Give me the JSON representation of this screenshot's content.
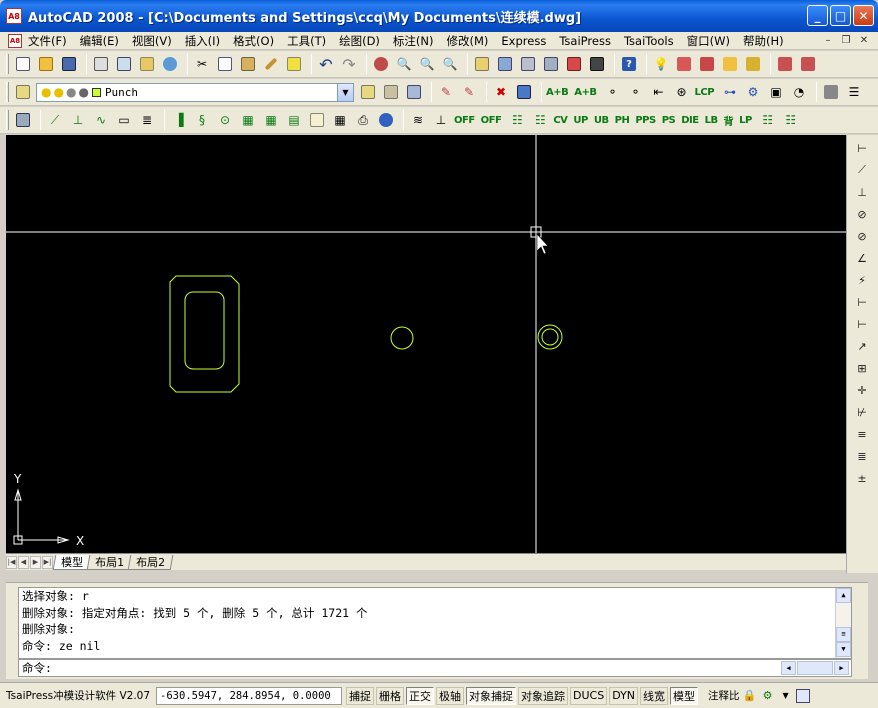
{
  "window": {
    "app_icon_text": "A8",
    "title": "AutoCAD 2008 - [C:\\Documents and Settings\\ccq\\My Documents\\连续模.dwg]",
    "buttons": {
      "minimize": "_",
      "maximize": "□",
      "close": "✕"
    }
  },
  "menu": {
    "items": [
      "文件(F)",
      "编辑(E)",
      "视图(V)",
      "插入(I)",
      "格式(O)",
      "工具(T)",
      "绘图(D)",
      "标注(N)",
      "修改(M)",
      "Express",
      "TsaiPress",
      "TsaiTools",
      "窗口(W)",
      "帮助(H)"
    ],
    "mdi_buttons": {
      "minimize": "–",
      "restore": "❐",
      "close": "✕"
    }
  },
  "toolbar_layers": {
    "layer_name": "Punch"
  },
  "toolbar_tsai": {
    "labels": [
      "A+B",
      "A+B",
      "LCP",
      "OFF",
      "OFF",
      "CV",
      "UP",
      "UB",
      "PH",
      "PPS",
      "PS",
      "DIE",
      "LB",
      "背",
      "LP"
    ]
  },
  "canvas": {
    "background": "#000000",
    "entity_color": "#c8ff32",
    "crosshair_color": "#ffffff",
    "ucs_x_label": "X",
    "ucs_y_label": "Y"
  },
  "layout_tabs": [
    "模型",
    "布局1",
    "布局2"
  ],
  "command": {
    "history": [
      "选择对象: r",
      "删除对象: 指定对角点: 找到 5 个, 删除 5 个, 总计 1721 个",
      "删除对象:",
      "命令: ze nil"
    ],
    "prompt": "命令:"
  },
  "status": {
    "app_label": "TsaiPress冲模设计软件 V2.07",
    "coordinates": "-630.5947, 284.8954, 0.0000",
    "toggles": [
      {
        "label": "捕捉",
        "on": false
      },
      {
        "label": "栅格",
        "on": false
      },
      {
        "label": "正交",
        "on": true
      },
      {
        "label": "极轴",
        "on": false
      },
      {
        "label": "对象捕捉",
        "on": true
      },
      {
        "label": "对象追踪",
        "on": false
      },
      {
        "label": "DUCS",
        "on": false
      },
      {
        "label": "DYN",
        "on": false
      },
      {
        "label": "线宽",
        "on": false
      },
      {
        "label": "模型",
        "on": true
      }
    ],
    "annotation_label": "注释比"
  }
}
